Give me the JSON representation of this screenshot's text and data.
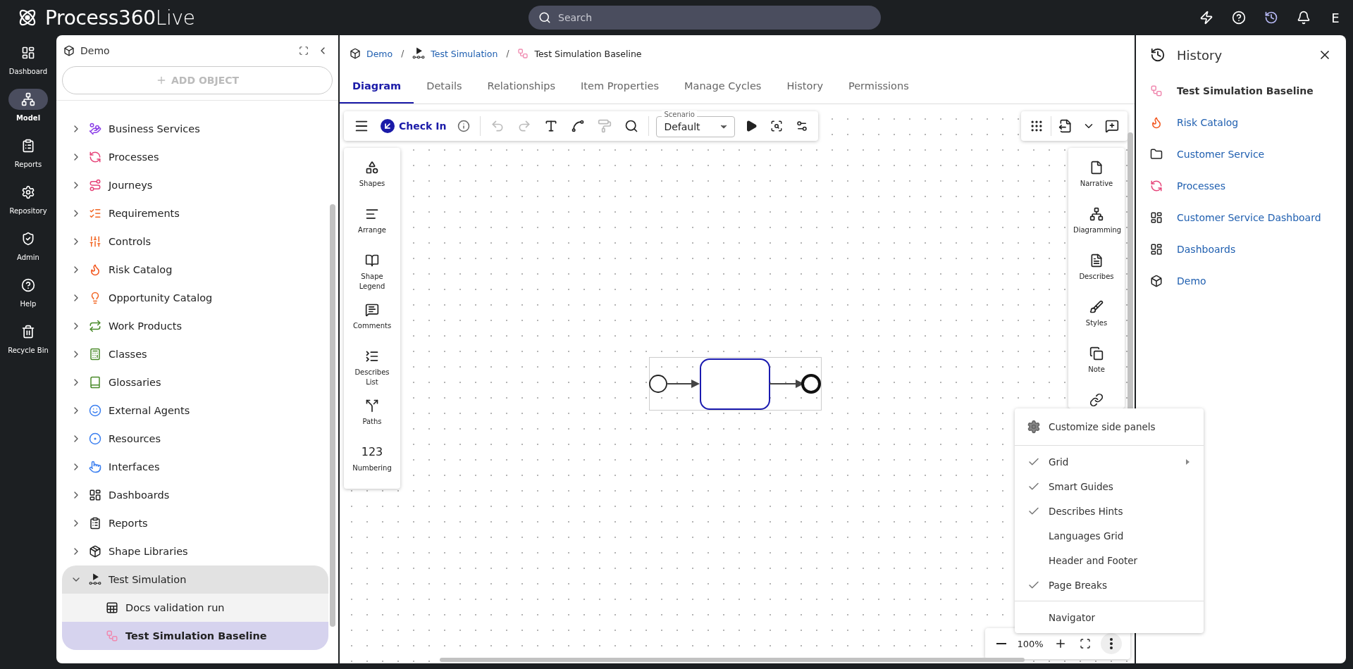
{
  "app": {
    "brand": "**Process360**Live"
  },
  "search": {
    "placeholder": "Search"
  },
  "top_actions": [
    {
      "kind": "bolt",
      "selected": false
    },
    {
      "kind": "help",
      "selected": false
    },
    {
      "kind": "history",
      "selected": true
    },
    {
      "kind": "bell",
      "selected": false
    }
  ],
  "user": {
    "initial": "E"
  },
  "nav": [
    {
      "label": "Dashboard",
      "kind": "dashboard",
      "selected": false
    },
    {
      "label": "Model",
      "kind": "model",
      "selected": true
    },
    {
      "label": "Reports",
      "kind": "reports",
      "selected": false
    },
    {
      "label": "Repository",
      "kind": "repository",
      "selected": false
    },
    {
      "label": "Admin",
      "kind": "admin",
      "selected": false
    },
    {
      "label": "Help",
      "kind": "help",
      "selected": false
    },
    {
      "label": "Recycle Bin",
      "kind": "bin",
      "selected": false
    }
  ],
  "tree": {
    "title": "Demo",
    "add_label": "ADD OBJECT",
    "items": [
      {
        "label": "Business Services",
        "kind": "business",
        "expanded": false
      },
      {
        "label": "Processes",
        "kind": "processes",
        "expanded": false
      },
      {
        "label": "Journeys",
        "kind": "journeys",
        "expanded": false
      },
      {
        "label": "Requirements",
        "kind": "requirements",
        "expanded": false
      },
      {
        "label": "Controls",
        "kind": "controls",
        "expanded": false
      },
      {
        "label": "Risk Catalog",
        "kind": "risk",
        "expanded": false
      },
      {
        "label": "Opportunity Catalog",
        "kind": "opportunity",
        "expanded": false
      },
      {
        "label": "Work Products",
        "kind": "work",
        "expanded": false
      },
      {
        "label": "Classes",
        "kind": "classes",
        "expanded": false
      },
      {
        "label": "Glossaries",
        "kind": "glossaries",
        "expanded": false
      },
      {
        "label": "External Agents",
        "kind": "agents",
        "expanded": false
      },
      {
        "label": "Resources",
        "kind": "resources",
        "expanded": false
      },
      {
        "label": "Interfaces",
        "kind": "interfaces",
        "expanded": false
      },
      {
        "label": "Dashboards",
        "kind": "dashboards",
        "expanded": false
      },
      {
        "label": "Reports",
        "kind": "reports",
        "expanded": false
      },
      {
        "label": "Shape Libraries",
        "kind": "libraries",
        "expanded": false
      },
      {
        "label": "Test Simulation",
        "kind": "simulation",
        "expanded": true,
        "children": [
          {
            "label": "Docs validation run",
            "kind": "run",
            "selected": false
          },
          {
            "label": "Test Simulation Baseline",
            "kind": "baseline",
            "selected": true
          }
        ]
      }
    ]
  },
  "breadcrumb": [
    {
      "label": "Demo",
      "kind": "cube"
    },
    {
      "separator": "/",
      "label": "Test Simulation",
      "kind": "simulation"
    },
    {
      "separator": "/",
      "label": "Test Simulation Baseline",
      "kind": "baseline"
    }
  ],
  "tabs": [
    {
      "label": "Diagram",
      "selected": true
    },
    {
      "label": "Details",
      "selected": false
    },
    {
      "label": "Relationships",
      "selected": false
    },
    {
      "label": "Item Properties",
      "selected": false
    },
    {
      "label": "Manage Cycles",
      "selected": false
    },
    {
      "label": "History",
      "selected": false
    },
    {
      "label": "Permissions",
      "selected": false
    }
  ],
  "toolbar": {
    "check_in": "Check In",
    "scenario_label": "Scenario",
    "scenario": "Default",
    "tools": [
      {
        "kind": "undo",
        "disabled": true
      },
      {
        "kind": "redo",
        "disabled": true
      },
      {
        "kind": "text",
        "disabled": false
      },
      {
        "kind": "connector",
        "disabled": false
      },
      {
        "kind": "painter",
        "disabled": true
      },
      {
        "kind": "search",
        "disabled": false
      }
    ]
  },
  "left_panel": [
    {
      "label": "Shapes",
      "kind": "shapes"
    },
    {
      "label": "Arrange",
      "kind": "arrange"
    },
    {
      "label": "Shape Legend",
      "kind": "legend"
    },
    {
      "label": "Comments",
      "kind": "comments"
    },
    {
      "label": "Describes List",
      "kind": "describes-list"
    },
    {
      "label": "Paths",
      "kind": "paths"
    },
    {
      "label": "Numbering",
      "kind": "numbering",
      "icon_text": "123"
    }
  ],
  "right_panel": [
    {
      "label": "Narrative",
      "kind": "narrative"
    },
    {
      "label": "Diagramming",
      "kind": "diagramming"
    },
    {
      "label": "Describes",
      "kind": "describes"
    },
    {
      "label": "Styles",
      "kind": "styles"
    },
    {
      "label": "Note",
      "kind": "note"
    },
    {
      "kind": "link"
    }
  ],
  "menu": {
    "sections": [
      {
        "items": [
          {
            "label": "Customize side panels",
            "kind": "gear"
          }
        ]
      },
      {
        "items": [
          {
            "label": "Grid",
            "kind": "check",
            "checked": true,
            "submenu": true
          },
          {
            "label": "Smart Guides",
            "kind": "check",
            "checked": true
          },
          {
            "label": "Describes Hints",
            "kind": "check",
            "checked": true
          },
          {
            "label": "Languages Grid",
            "kind": "check",
            "checked": false
          },
          {
            "label": "Header and Footer",
            "kind": "check",
            "checked": false
          },
          {
            "label": "Page Breaks",
            "kind": "check",
            "checked": true
          }
        ]
      },
      {
        "items": [
          {
            "label": "Navigator",
            "kind": "check",
            "checked": false
          }
        ]
      }
    ]
  },
  "zoom": {
    "reading": "100%"
  },
  "history": {
    "title": "History",
    "items": [
      {
        "label": "Test Simulation Baseline",
        "kind": "baseline",
        "current": true
      },
      {
        "label": "Risk Catalog",
        "kind": "risk",
        "current": false
      },
      {
        "label": "Customer Service",
        "kind": "folder",
        "current": false
      },
      {
        "label": "Processes",
        "kind": "processes",
        "current": false
      },
      {
        "label": "Customer Service Dashboard",
        "kind": "dashboards",
        "current": false
      },
      {
        "label": "Dashboards",
        "kind": "dashboards",
        "current": false
      },
      {
        "label": "Demo",
        "kind": "cube",
        "current": false
      }
    ]
  }
}
